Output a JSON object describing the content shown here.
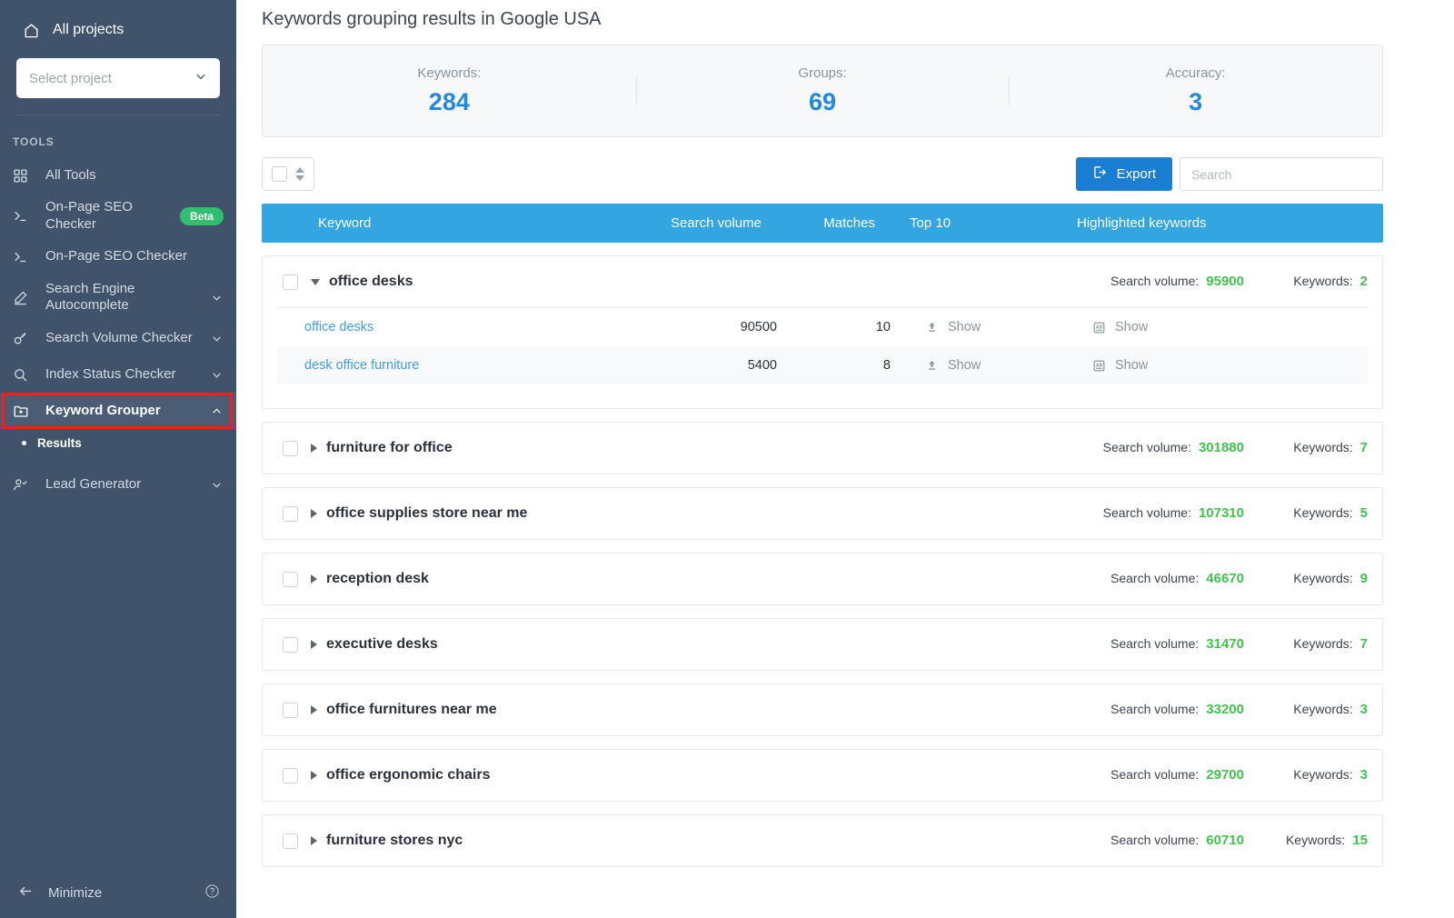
{
  "sidebar": {
    "all_projects_label": "All projects",
    "project_select_placeholder": "Select project",
    "section_title": "TOOLS",
    "items": [
      {
        "label": "All Tools",
        "icon": "grid-icon",
        "chevron": "",
        "badge": ""
      },
      {
        "label": "On-Page SEO Checker",
        "icon": "terminal-icon",
        "chevron": "",
        "badge": "Beta"
      },
      {
        "label": "On-Page SEO Checker",
        "icon": "terminal-icon",
        "chevron": "",
        "badge": ""
      },
      {
        "label": "Search Engine Autocomplete",
        "icon": "pencil-icon",
        "chevron": "chevron-down-icon",
        "badge": ""
      },
      {
        "label": "Search Volume Checker",
        "icon": "key-icon",
        "chevron": "chevron-down-icon",
        "badge": ""
      },
      {
        "label": "Index Status Checker",
        "icon": "search-icon",
        "chevron": "chevron-down-icon",
        "badge": ""
      },
      {
        "label": "Keyword Grouper",
        "icon": "folder-plus-icon",
        "chevron": "chevron-up-icon",
        "badge": ""
      },
      {
        "label": "Lead Generator",
        "icon": "user-check-icon",
        "chevron": "chevron-down-icon",
        "badge": ""
      }
    ],
    "sub_item_label": "Results",
    "minimize_label": "Minimize",
    "highlight_color": "#f81d1d"
  },
  "header": {
    "title": "Keywords grouping results in Google USA"
  },
  "stats": [
    {
      "label": "Keywords:",
      "value": "284"
    },
    {
      "label": "Groups:",
      "value": "69"
    },
    {
      "label": "Accuracy:",
      "value": "3"
    }
  ],
  "toolbar": {
    "export_label": "Export",
    "export_icon": "export-icon",
    "search_placeholder": "Search",
    "search_value": ""
  },
  "table": {
    "columns": {
      "keyword": "Keyword",
      "search_volume": "Search volume",
      "matches": "Matches",
      "top10": "Top 10",
      "highlighted": "Highlighted keywords"
    },
    "meta_labels": {
      "search_volume": "Search volume:",
      "keywords": "Keywords:"
    },
    "show_label": "Show",
    "groups": [
      {
        "name": "office desks",
        "expanded": true,
        "search_volume": "95900",
        "keywords": "2",
        "rows": [
          {
            "keyword": "office desks",
            "volume": "90500",
            "matches": "10",
            "top10": "Show",
            "highlighted": "Show"
          },
          {
            "keyword": "desk office furniture",
            "volume": "5400",
            "matches": "8",
            "top10": "Show",
            "highlighted": "Show"
          }
        ]
      },
      {
        "name": "furniture for office",
        "expanded": false,
        "search_volume": "301880",
        "keywords": "7",
        "rows": []
      },
      {
        "name": "office supplies store near me",
        "expanded": false,
        "search_volume": "107310",
        "keywords": "5",
        "rows": []
      },
      {
        "name": "reception desk",
        "expanded": false,
        "search_volume": "46670",
        "keywords": "9",
        "rows": []
      },
      {
        "name": "executive desks",
        "expanded": false,
        "search_volume": "31470",
        "keywords": "7",
        "rows": []
      },
      {
        "name": "office furnitures near me",
        "expanded": false,
        "search_volume": "33200",
        "keywords": "3",
        "rows": []
      },
      {
        "name": "office ergonomic chairs",
        "expanded": false,
        "search_volume": "29700",
        "keywords": "3",
        "rows": []
      },
      {
        "name": "furniture stores nyc",
        "expanded": false,
        "search_volume": "60710",
        "keywords": "15",
        "rows": []
      }
    ]
  },
  "colors": {
    "sidebar_bg": "#41536b",
    "accent_blue": "#1a7fd4",
    "header_blue": "#33a5e0",
    "value_green": "#3fc34b",
    "stat_blue": "#1e88e5",
    "beta_green": "#2fbf6e"
  }
}
